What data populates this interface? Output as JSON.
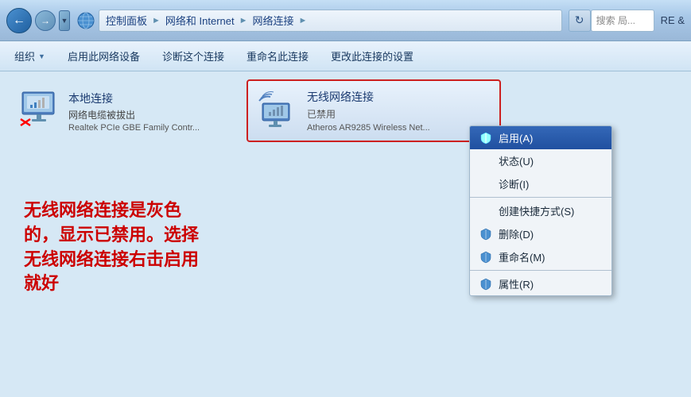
{
  "titleBar": {
    "breadcrumb": {
      "items": [
        "控制面板",
        "网络和 Internet",
        "网络连接"
      ]
    },
    "refreshLabel": "↻",
    "searchPlaceholder": "搜索 局..."
  },
  "toolbar": {
    "buttons": [
      {
        "label": "组织",
        "hasArrow": true
      },
      {
        "label": "启用此网络设备",
        "hasArrow": false
      },
      {
        "label": "诊断这个连接",
        "hasArrow": false
      },
      {
        "label": "重命名此连接",
        "hasArrow": false
      },
      {
        "label": "更改此连接的设置",
        "hasArrow": false
      }
    ]
  },
  "networkItems": {
    "local": {
      "name": "本地连接",
      "status": "网络电缆被拔出",
      "adapter": "Realtek PCIe GBE Family Contr..."
    },
    "wireless": {
      "name": "无线网络连接",
      "status": "已禁用",
      "adapter": "Atheros AR9285 Wireless Net..."
    }
  },
  "contextMenu": {
    "items": [
      {
        "label": "启用(A)",
        "hasShield": true,
        "highlighted": true
      },
      {
        "label": "状态(U)",
        "hasShield": false
      },
      {
        "label": "诊断(I)",
        "hasShield": false
      },
      {
        "separator": true
      },
      {
        "label": "创建快捷方式(S)",
        "hasShield": false
      },
      {
        "label": "删除(D)",
        "hasShield": true
      },
      {
        "label": "重命名(M)",
        "hasShield": true
      },
      {
        "separator": true
      },
      {
        "label": "属性(R)",
        "hasShield": true
      }
    ]
  },
  "annotation": {
    "text": "无线网络连接是灰色的，显示已禁用。选择无线网络连接右击启用就好"
  }
}
